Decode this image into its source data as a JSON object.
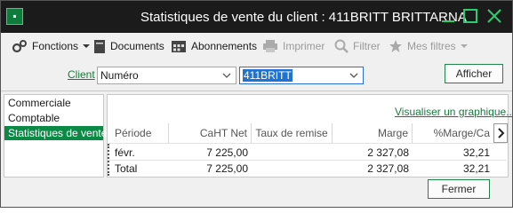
{
  "window": {
    "title": "Statistiques de vente du client : 411BRITT BRITTARNA",
    "app_icon_glyph": "▪",
    "colors": {
      "titlebar": "#1b1b1b",
      "accent": "#0b8a45",
      "link": "#1a7a3c"
    }
  },
  "toolbar": {
    "fonctions": "Fonctions",
    "documents": "Documents",
    "abonnements": "Abonnements",
    "imprimer": "Imprimer",
    "filtrer": "Filtrer",
    "mes_filtres": "Mes filtres"
  },
  "search": {
    "client_label": "Client",
    "field_select": "Numéro",
    "client_value": "411BRITT",
    "afficher_label": "Afficher"
  },
  "sidebar": {
    "items": [
      {
        "label": "Commerciale",
        "active": false
      },
      {
        "label": "Comptable",
        "active": false
      },
      {
        "label": "Statistiques de vente",
        "active": true
      }
    ]
  },
  "main": {
    "graph_link": "Visualiser un graphique...",
    "columns": [
      "Période",
      "CaHT Net",
      "Taux de remise",
      "Marge",
      "%Marge/Ca"
    ],
    "rows": [
      {
        "periode": "févr.",
        "caht": "7 225,00",
        "taux": "",
        "marge": "2 327,08",
        "pct": "32,21"
      },
      {
        "periode": "Total",
        "caht": "7 225,00",
        "taux": "",
        "marge": "2 327,08",
        "pct": "32,21"
      }
    ]
  },
  "footer": {
    "fermer_label": "Fermer"
  }
}
